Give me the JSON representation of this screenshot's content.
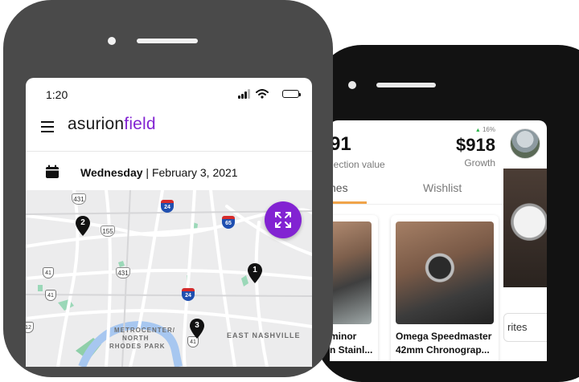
{
  "front_phone": {
    "status_bar": {
      "time": "1:20"
    },
    "header": {
      "logo_part1": "asurion",
      "logo_part2": "field"
    },
    "date_row": {
      "day": "Wednesday",
      "separator": " | ",
      "date": "February 3, 2021"
    },
    "map": {
      "pins": [
        "2",
        "1",
        "3"
      ],
      "labels": {
        "east_nashville": "EAST NASHVILLE",
        "metrocenter": "METROCENTER/",
        "north": "NORTH",
        "rhodes_park": "RHODES PARK"
      },
      "route_shields": [
        "431",
        "155",
        "431",
        "41",
        "41",
        "12",
        "41"
      ],
      "interstate_shields": [
        "24",
        "65",
        "24"
      ]
    }
  },
  "back_phone": {
    "collection": {
      "value": "91",
      "label": "lection value"
    },
    "growth": {
      "percent": "16%",
      "value": "$918",
      "label": "Growth"
    },
    "tabs": {
      "homes": "nes",
      "wishlist": "Wishlist"
    },
    "cards": [
      {
        "title_line1": "minor",
        "title_line2": "n Stainl..."
      },
      {
        "title_line1": "Omega Speedmaster",
        "title_line2": "42mm Chronograp..."
      }
    ],
    "side_button": "rites"
  },
  "colors": {
    "brand_purple": "#8223d2",
    "tab_accent": "#f0a44a",
    "growth_green": "#2cb34a"
  }
}
